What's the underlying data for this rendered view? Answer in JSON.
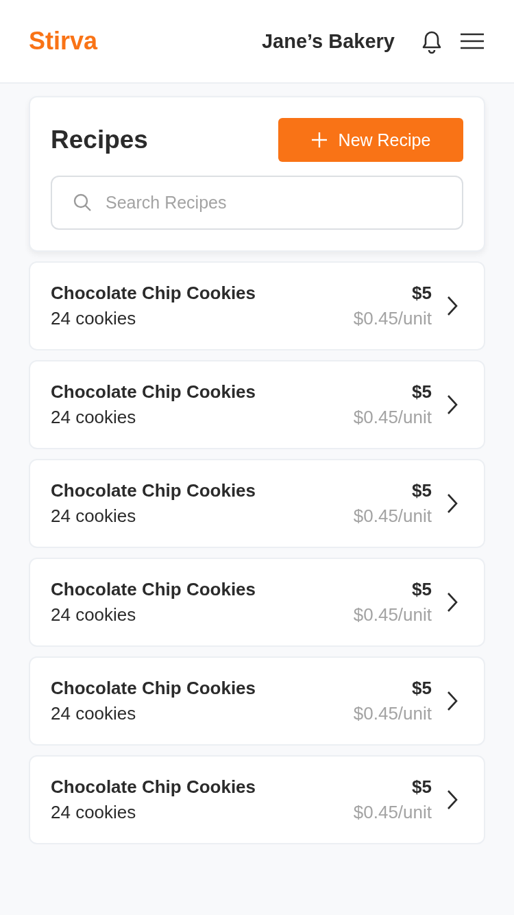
{
  "header": {
    "logo": "Stirva",
    "business": "Jane’s Bakery"
  },
  "panel": {
    "title": "Recipes",
    "new_button": "New Recipe",
    "search": {
      "placeholder": "Search Recipes"
    }
  },
  "recipes": [
    {
      "name": "Chocolate Chip Cookies",
      "yield": "24 cookies",
      "price": "$5",
      "unit_cost": "$0.45/unit"
    },
    {
      "name": "Chocolate Chip Cookies",
      "yield": "24 cookies",
      "price": "$5",
      "unit_cost": "$0.45/unit"
    },
    {
      "name": "Chocolate Chip Cookies",
      "yield": "24 cookies",
      "price": "$5",
      "unit_cost": "$0.45/unit"
    },
    {
      "name": "Chocolate Chip Cookies",
      "yield": "24 cookies",
      "price": "$5",
      "unit_cost": "$0.45/unit"
    },
    {
      "name": "Chocolate Chip Cookies",
      "yield": "24 cookies",
      "price": "$5",
      "unit_cost": "$0.45/unit"
    },
    {
      "name": "Chocolate Chip Cookies",
      "yield": "24 cookies",
      "price": "$5",
      "unit_cost": "$0.45/unit"
    }
  ]
}
